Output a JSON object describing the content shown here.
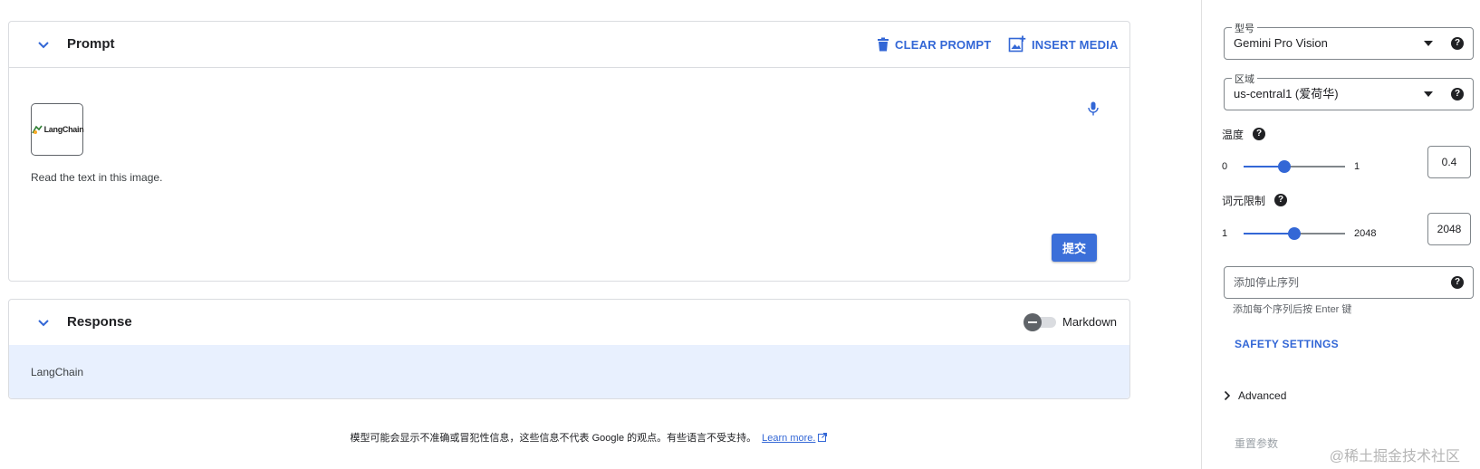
{
  "prompt_panel": {
    "title": "Prompt",
    "clear_label": "CLEAR PROMPT",
    "insert_label": "INSERT MEDIA",
    "image_logo_text": "LangChain",
    "prompt_text": "Read the text in this image.",
    "submit_label": "提交"
  },
  "response_panel": {
    "title": "Response",
    "markdown_label": "Markdown",
    "markdown_enabled": false,
    "response_text": "LangChain"
  },
  "disclaimer": {
    "text": "模型可能会显示不准确或冒犯性信息，这些信息不代表 Google 的观点。有些语言不受支持。",
    "link_label": "Learn more."
  },
  "settings": {
    "model": {
      "label": "型号",
      "value": "Gemini Pro Vision"
    },
    "region": {
      "label": "区域",
      "value": "us-central1 (爱荷华)"
    },
    "temperature": {
      "label": "温度",
      "min": "0",
      "max": "1",
      "value": "0.4",
      "fraction": 0.4
    },
    "token_limit": {
      "label": "词元限制",
      "min": "1",
      "max": "2048",
      "value": "2048",
      "fraction": 0.5
    },
    "stop_sequence": {
      "placeholder": "添加停止序列",
      "hint": "添加每个序列后按 Enter 键"
    },
    "safety_label": "SAFETY SETTINGS",
    "advanced_label": "Advanced",
    "reset_label": "重置参数"
  },
  "watermark": "@稀土掘金技术社区",
  "colors": {
    "accent": "#3367d6",
    "response_bg": "#e8f0fe",
    "button": "#3b6fd9"
  }
}
